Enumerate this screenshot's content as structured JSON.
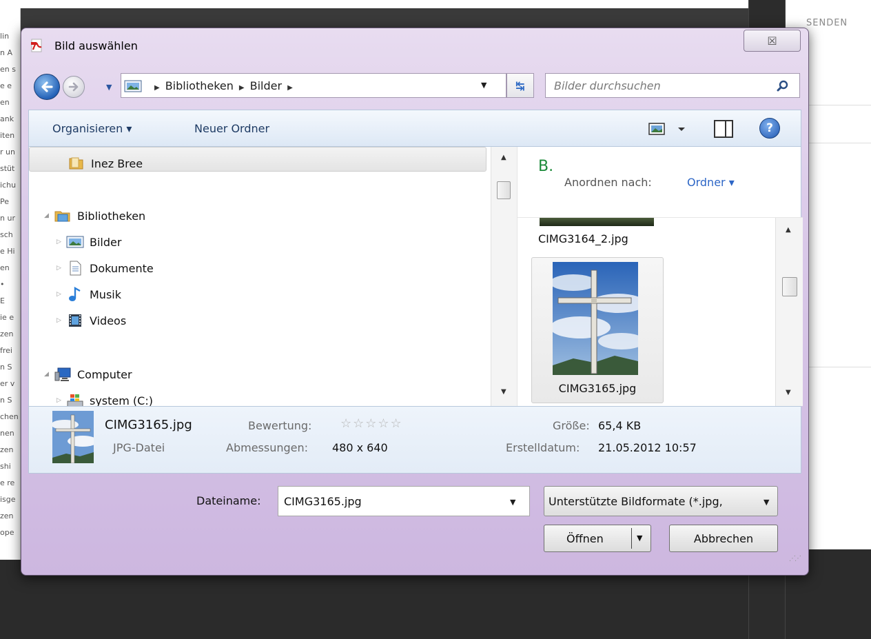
{
  "background": {
    "left_fragments": [
      "lin",
      "n A",
      "en s",
      "e e",
      "en",
      "ank",
      "iten",
      "r un",
      "stüt",
      "ichu",
      "Pe",
      "n ur",
      "sch",
      "e Hi",
      "en",
      "•",
      "E",
      "ie e",
      "zen",
      "frei",
      "n S",
      "er v",
      "n S",
      "chen",
      "nen",
      "zen",
      "shi",
      "e re",
      "isge",
      "zen",
      "ope"
    ],
    "right_tag": "SENDEN"
  },
  "dialog": {
    "title": "Bild auswählen",
    "close_glyph": "☒"
  },
  "nav": {
    "breadcrumbs": [
      "Bibliotheken",
      "Bilder"
    ],
    "search_placeholder": "Bilder durchsuchen"
  },
  "toolbar": {
    "organize": "Organisieren ▾",
    "new_folder": "Neuer Ordner",
    "help": "?"
  },
  "tree": {
    "items": [
      {
        "label": "Inez Bree"
      },
      {
        "label": "Bibliotheken"
      },
      {
        "label": "Bilder"
      },
      {
        "label": "Dokumente"
      },
      {
        "label": "Musik"
      },
      {
        "label": "Videos"
      },
      {
        "label": "Computer"
      },
      {
        "label": "system (C:)"
      }
    ]
  },
  "pane": {
    "title_letter": "B.",
    "arrange_label": "Anordnen nach:",
    "arrange_value": "Ordner ▾",
    "files": [
      "CIMG3164_2.jpg",
      "CIMG3165.jpg"
    ]
  },
  "details": {
    "name": "CIMG3165.jpg",
    "type": "JPG-Datei",
    "rating_label": "Bewertung:",
    "rating_stars": "☆☆☆☆☆",
    "dimensions_label": "Abmessungen:",
    "dimensions_value": "480 x 640",
    "size_label": "Größe:",
    "size_value": "65,4 KB",
    "created_label": "Erstelldatum:",
    "created_value": "21.05.2012 10:57"
  },
  "bottom": {
    "filename_label": "Dateiname:",
    "filename_value": "CIMG3165.jpg",
    "filter_value": "Unterstützte Bildformate (*.jpg,",
    "open_label": "Öffnen",
    "cancel_label": "Abbrechen"
  }
}
